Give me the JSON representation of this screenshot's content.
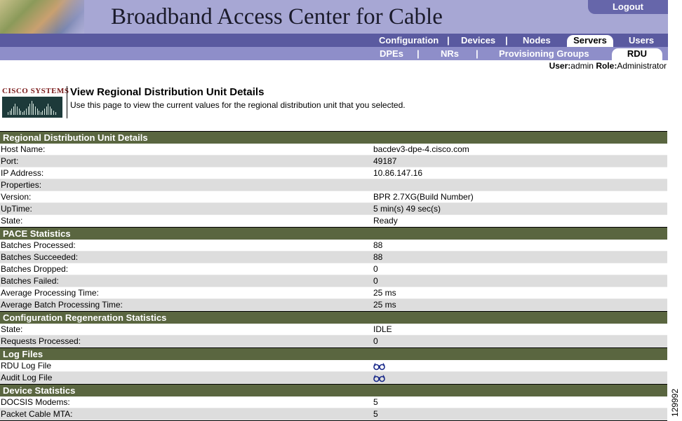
{
  "app": {
    "title": "Broadband Access Center for Cable",
    "logout": "Logout"
  },
  "nav": {
    "primary": [
      {
        "label": "Configuration",
        "active": false
      },
      {
        "label": "Devices",
        "active": false
      },
      {
        "label": "Nodes",
        "active": false
      },
      {
        "label": "Servers",
        "active": true
      },
      {
        "label": "Users",
        "active": false
      }
    ],
    "secondary": [
      {
        "label": "DPEs",
        "active": false
      },
      {
        "label": "NRs",
        "active": false
      },
      {
        "label": "Provisioning Groups",
        "active": false
      },
      {
        "label": "RDU",
        "active": true
      }
    ],
    "separator": "|"
  },
  "user": {
    "user_label": "User:",
    "user_value": "admin",
    "role_label": "Role:",
    "role_value": "Administrator"
  },
  "header": {
    "logo_text": "Cisco Systems",
    "title": "View Regional Distribution Unit Details",
    "description": "Use this page to view the current values for the regional distribution unit that you selected."
  },
  "sections": [
    {
      "title": "Regional Distribution Unit Details",
      "rows": [
        {
          "label": "Host Name:",
          "value": "bacdev3-dpe-4.cisco.com"
        },
        {
          "label": "Port:",
          "value": "49187"
        },
        {
          "label": "IP Address:",
          "value": "10.86.147.16"
        },
        {
          "label": "Properties:",
          "value": ""
        },
        {
          "label": "Version:",
          "value": "BPR 2.7XG(Build Number)"
        },
        {
          "label": "UpTime:",
          "value": "5 min(s) 49 sec(s)"
        },
        {
          "label": "State:",
          "value": "Ready"
        }
      ]
    },
    {
      "title": "PACE Statistics",
      "rows": [
        {
          "label": "Batches Processed:",
          "value": "88"
        },
        {
          "label": "Batches Succeeded:",
          "value": "88"
        },
        {
          "label": "Batches Dropped:",
          "value": "0"
        },
        {
          "label": "Batches Failed:",
          "value": "0"
        },
        {
          "label": "Average Processing Time:",
          "value": "25 ms"
        },
        {
          "label": "Average Batch Processing Time:",
          "value": "25 ms"
        }
      ]
    },
    {
      "title": "Configuration Regeneration Statistics",
      "rows": [
        {
          "label": "State:",
          "value": "IDLE"
        },
        {
          "label": "Requests Processed:",
          "value": "0"
        }
      ]
    },
    {
      "title": "Log Files",
      "rows": [
        {
          "label": "RDU Log File",
          "value": "",
          "icon": "view-glasses-icon"
        },
        {
          "label": "Audit Log File",
          "value": "",
          "icon": "view-glasses-icon"
        }
      ]
    },
    {
      "title": "Device Statistics",
      "rows": [
        {
          "label": "DOCSIS Modems:",
          "value": "5"
        },
        {
          "label": "Packet Cable MTA:",
          "value": "5"
        }
      ]
    }
  ],
  "figure_id": "129992",
  "colors": {
    "banner": "#a7a7d4",
    "nav_primary": "#5a5aa0",
    "nav_secondary": "#8e8ec9",
    "section_header": "#5a6640",
    "row_alt": "#dddddd"
  }
}
